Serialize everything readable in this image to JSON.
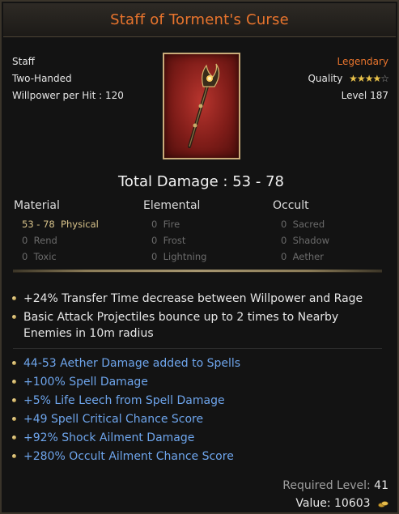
{
  "item": {
    "name": "Staff of Torment's Curse",
    "type": "Staff",
    "handedness": "Two-Handed",
    "willpower": "Willpower per Hit : 120",
    "rarity": "Legendary",
    "quality_label": "Quality",
    "quality_stars": 4,
    "quality_max": 5,
    "level": "Level 187",
    "total_damage": "Total Damage : 53 - 78"
  },
  "damage": {
    "material": {
      "header": "Material",
      "rows": [
        {
          "value": "53 - 78",
          "label": "Physical"
        },
        {
          "value": "0",
          "label": "Rend"
        },
        {
          "value": "0",
          "label": "Toxic"
        }
      ]
    },
    "elemental": {
      "header": "Elemental",
      "rows": [
        {
          "value": "0",
          "label": "Fire"
        },
        {
          "value": "0",
          "label": "Frost"
        },
        {
          "value": "0",
          "label": "Lightning"
        }
      ]
    },
    "occult": {
      "header": "Occult",
      "rows": [
        {
          "value": "0",
          "label": "Sacred"
        },
        {
          "value": "0",
          "label": "Shadow"
        },
        {
          "value": "0",
          "label": "Aether"
        }
      ]
    }
  },
  "implicit_mods": [
    "+24% Transfer Time decrease between Willpower and Rage",
    "Basic Attack Projectiles bounce up to 2 times to Nearby",
    "Enemies in 10m radius"
  ],
  "affix_mods": [
    "44-53 Aether Damage added to Spells",
    "+100% Spell Damage",
    "+5% Life Leech from Spell Damage",
    "+49 Spell Critical Chance Score",
    "+92% Shock Ailment Damage",
    "+280% Occult Ailment Chance Score"
  ],
  "footer": {
    "required_label": "Required Level:",
    "required_value": "41",
    "value_label": "Value:",
    "value_amount": "10603"
  },
  "icons": {
    "star": "star-icon",
    "coin": "gold-coin-icon",
    "bullet": "bullet-icon"
  },
  "colors": {
    "title": "#e8742d",
    "legendary": "#e8742d",
    "mod_blue": "#6ea5ec",
    "active_damage": "#d7c28a",
    "inactive_damage": "#6b6b6b",
    "star_gold": "#e9c24a"
  }
}
